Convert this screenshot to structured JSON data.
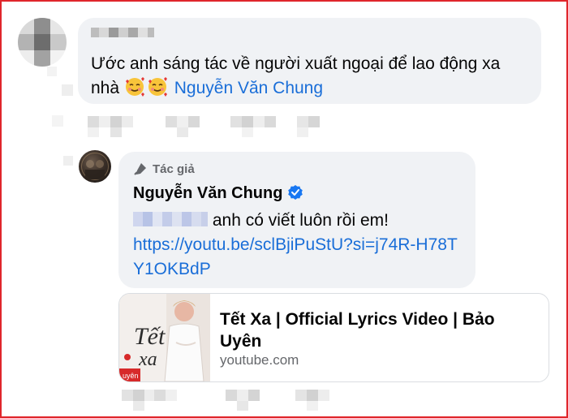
{
  "comment": {
    "text": "Ước anh sáng tác về người xuất ngoại để lao động xa nhà",
    "mention": "Nguyễn Văn Chung",
    "emoji": "smiling-face-with-hearts-icon"
  },
  "reply": {
    "badge": "Tác giả",
    "name": "Nguyễn Văn Chung",
    "text": "anh có viết luôn rồi em!",
    "link": "https://youtu.be/sclBjiPuStU?si=j74R-H78TY1OKBdP"
  },
  "preview": {
    "title": "Tết Xa | Official Lyrics Video | Bảo Uyên",
    "domain": "youtube.com"
  },
  "colors": {
    "frame": "#e0262b",
    "bubble": "#f0f2f5",
    "link": "#1a6ed8",
    "verified": "#1877f2"
  }
}
